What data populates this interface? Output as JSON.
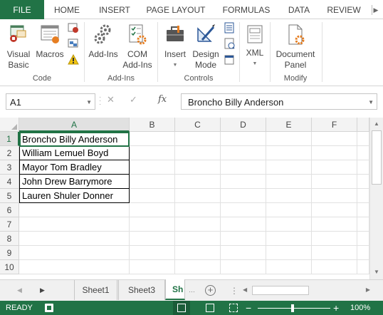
{
  "ribbon_tabs": {
    "file": "FILE",
    "home": "HOME",
    "insert": "INSERT",
    "page_layout": "PAGE LAYOUT",
    "formulas": "FORMULAS",
    "data": "DATA",
    "review": "REVIEW"
  },
  "ribbon": {
    "code": {
      "label": "Code",
      "visual_basic_line1": "Visual",
      "visual_basic_line2": "Basic",
      "macros": "Macros"
    },
    "addins": {
      "label": "Add-Ins",
      "addins": "Add-Ins",
      "com_line1": "COM",
      "com_line2": "Add-Ins"
    },
    "controls": {
      "label": "Controls",
      "insert": "Insert",
      "design_line1": "Design",
      "design_line2": "Mode"
    },
    "xml": {
      "xml": "XML"
    },
    "modify": {
      "label": "Modify",
      "doc_panel_line1": "Document",
      "doc_panel_line2": "Panel"
    }
  },
  "formula_bar": {
    "name_box": "A1",
    "fx": "fx",
    "value": "Broncho Billy Anderson"
  },
  "grid": {
    "columns": [
      "A",
      "B",
      "C",
      "D",
      "E",
      "F"
    ],
    "rows": [
      "1",
      "2",
      "3",
      "4",
      "5",
      "6",
      "7",
      "8",
      "9",
      "10"
    ],
    "cells_A": [
      "Broncho Billy Anderson",
      "William Lemuel Boyd",
      "Mayor Tom Bradley",
      "John Drew Barrymore",
      "Lauren Shuler Donner"
    ]
  },
  "sheet_tabs": {
    "tab1": "Sheet1",
    "tab2": "Sheet3",
    "tab3": "Sh"
  },
  "status_bar": {
    "status": "READY",
    "zoom": "100%"
  },
  "colors": {
    "excel_green": "#217346",
    "gear_orange": "#e67e22",
    "ribbon_text": "#444444"
  }
}
